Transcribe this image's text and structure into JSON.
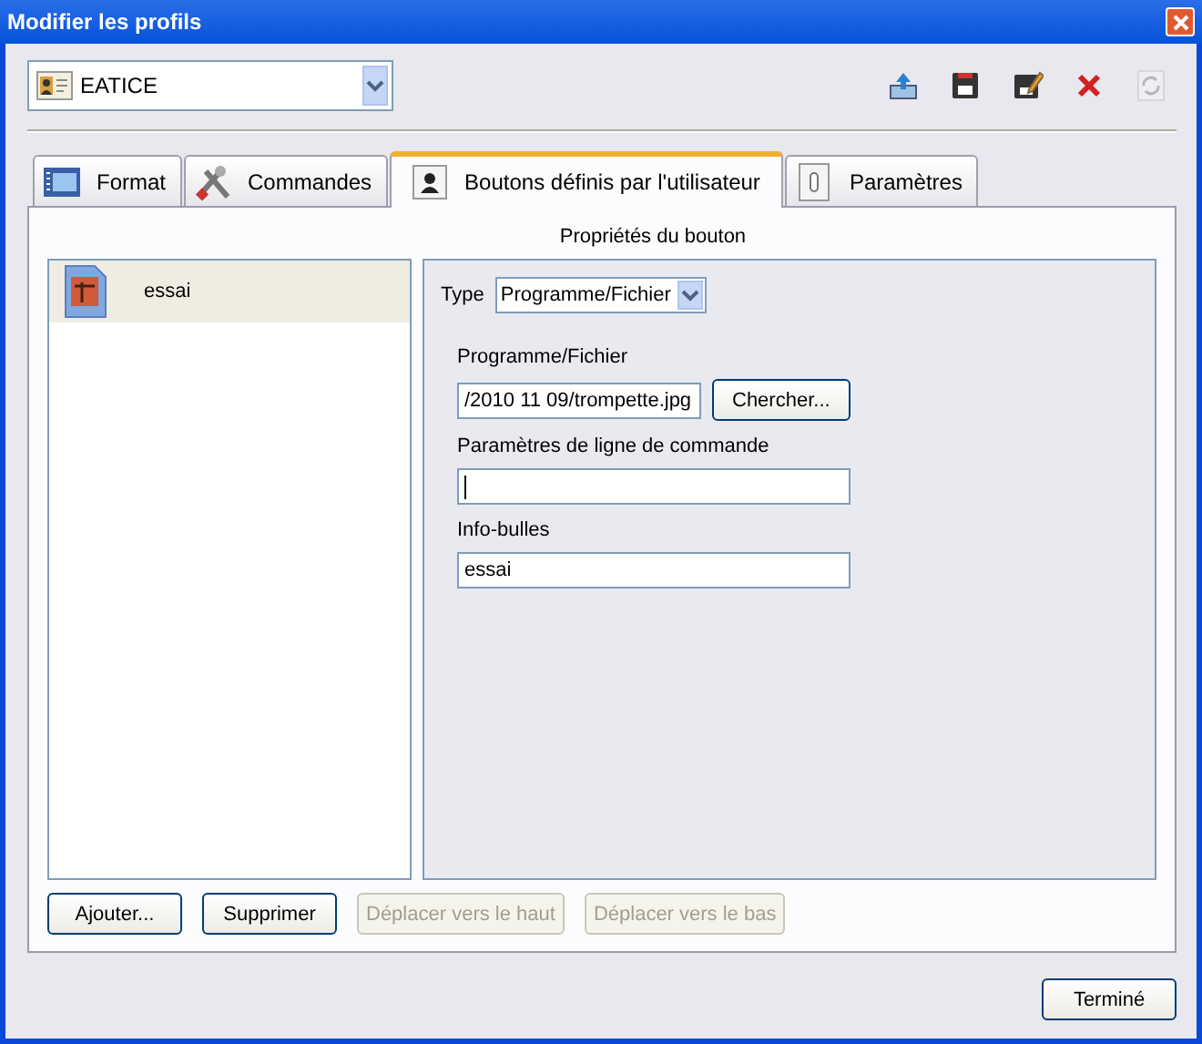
{
  "window": {
    "title": "Modifier les profils"
  },
  "profile": {
    "value": "EATICE"
  },
  "toolbar": [
    {
      "kind": "export"
    },
    {
      "kind": "save"
    },
    {
      "kind": "edit"
    },
    {
      "kind": "delete"
    },
    {
      "kind": "refresh",
      "disabled": true
    }
  ],
  "tabs": [
    {
      "label": "Format",
      "kind": "format",
      "selected": false
    },
    {
      "label": "Commandes",
      "kind": "tools",
      "selected": false
    },
    {
      "label": "Boutons définis par l'utilisateur",
      "kind": "user",
      "selected": true
    },
    {
      "label": "Paramètres",
      "kind": "params",
      "selected": false
    }
  ],
  "section_title": "Propriétés du bouton",
  "buttons_list": [
    {
      "label": "essai",
      "selected": true
    }
  ],
  "properties": {
    "type_label": "Type",
    "type_value": "Programme/Fichier",
    "program_label": "Programme/Fichier",
    "program_value": "/2010 11 09/trompette.jpg",
    "browse": "Chercher...",
    "params_label": "Paramètres de ligne de commande",
    "params_focused": true,
    "tooltip_label": "Info-bulles",
    "tooltip_value": "essai"
  },
  "actions": [
    {
      "label": "Ajouter...",
      "disabled": false
    },
    {
      "label": "Supprimer",
      "disabled": false
    },
    {
      "label": "Déplacer vers le haut",
      "disabled": true
    },
    {
      "label": "Déplacer vers le bas",
      "disabled": true
    }
  ],
  "done": "Terminé"
}
